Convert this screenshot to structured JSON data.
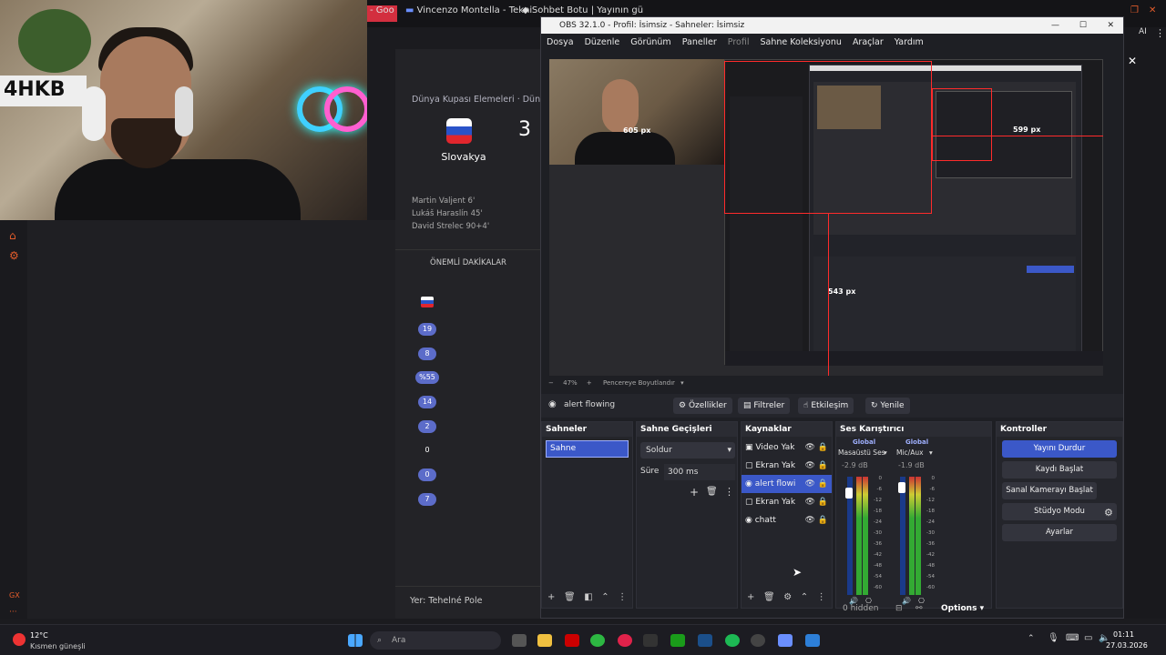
{
  "browser": {
    "tabs": [
      "- Goo",
      "Vincenzo Montella - Tekni",
      "Sohbet Botu | Yayının gü"
    ],
    "ai_label": "AI"
  },
  "match": {
    "competition": "Dünya Kupası Elemeleri · Dün",
    "team": "Slovakya",
    "score": "3",
    "scorers": [
      "Martin Valjent 6'",
      "Lukáš Haraslín 45'",
      "David Strelec 90+4'"
    ],
    "key_moments_title": "ÖNEMLİ DAKİKALAR",
    "stat_pills": [
      "19",
      "8",
      "%55",
      "14",
      "2",
      "0",
      "0",
      "7"
    ],
    "venue": "Yer: Tehelné Pole"
  },
  "sidebar": {
    "gx_label": "GX"
  },
  "obs": {
    "title": "OBS 32.1.0 - Profil: İsimsiz - Sahneler: İsimsiz",
    "menu": [
      "Dosya",
      "Düzenle",
      "Görünüm",
      "Paneller",
      "Profil",
      "Sahne Koleksiyonu",
      "Araçlar",
      "Yardım"
    ],
    "preview": {
      "measure_w": "605 px",
      "measure_w2": "599 px",
      "measure_h": "543 px",
      "zoom": "47%",
      "fit_label": "Pencereye Boyutlandır"
    },
    "source_bar": {
      "selected_source": "alert flowing",
      "properties": "Özellikler",
      "filters": "Filtreler",
      "interact": "Etkileşim",
      "refresh": "Yenile"
    },
    "scenes": {
      "title": "Sahneler",
      "items": [
        "Sahne"
      ]
    },
    "transitions": {
      "title": "Sahne Geçişleri",
      "type": "Soldur",
      "duration_label": "Süre",
      "duration": "300 ms"
    },
    "sources": {
      "title": "Kaynaklar",
      "items": [
        {
          "name": "Video Yak",
          "icon": "camera-icon"
        },
        {
          "name": "Ekran Yak",
          "icon": "monitor-icon"
        },
        {
          "name": "alert flowi",
          "icon": "globe-icon"
        },
        {
          "name": "Ekran Yak",
          "icon": "monitor-icon"
        },
        {
          "name": "chatt",
          "icon": "globe-icon"
        }
      ]
    },
    "mixer": {
      "title": "Ses Karıştırıcı",
      "channels": [
        {
          "name": "Masaüstü Ses",
          "global": "Global",
          "db": "-2.9 dB"
        },
        {
          "name": "Mic/Aux",
          "global": "Global",
          "db": "-1.9 dB"
        }
      ],
      "scale": [
        "0",
        "-6",
        "-12",
        "-18",
        "-24",
        "-30",
        "-36",
        "-42",
        "-48",
        "-54",
        "-60"
      ],
      "hidden": "0 hidden",
      "options": "Options"
    },
    "controls": {
      "title": "Kontroller",
      "stop_stream": "Yayını Durdur",
      "start_record": "Kaydı Başlat",
      "virtual_cam": "Sanal Kamerayı Başlat",
      "studio_mode": "Stüdyo Modu",
      "settings": "Ayarlar"
    }
  },
  "taskbar": {
    "weather_temp": "12°C",
    "weather_desc": "Kısmen güneşli",
    "search_placeholder": "Ara",
    "time": "01:11",
    "date": "27.03.2026"
  }
}
